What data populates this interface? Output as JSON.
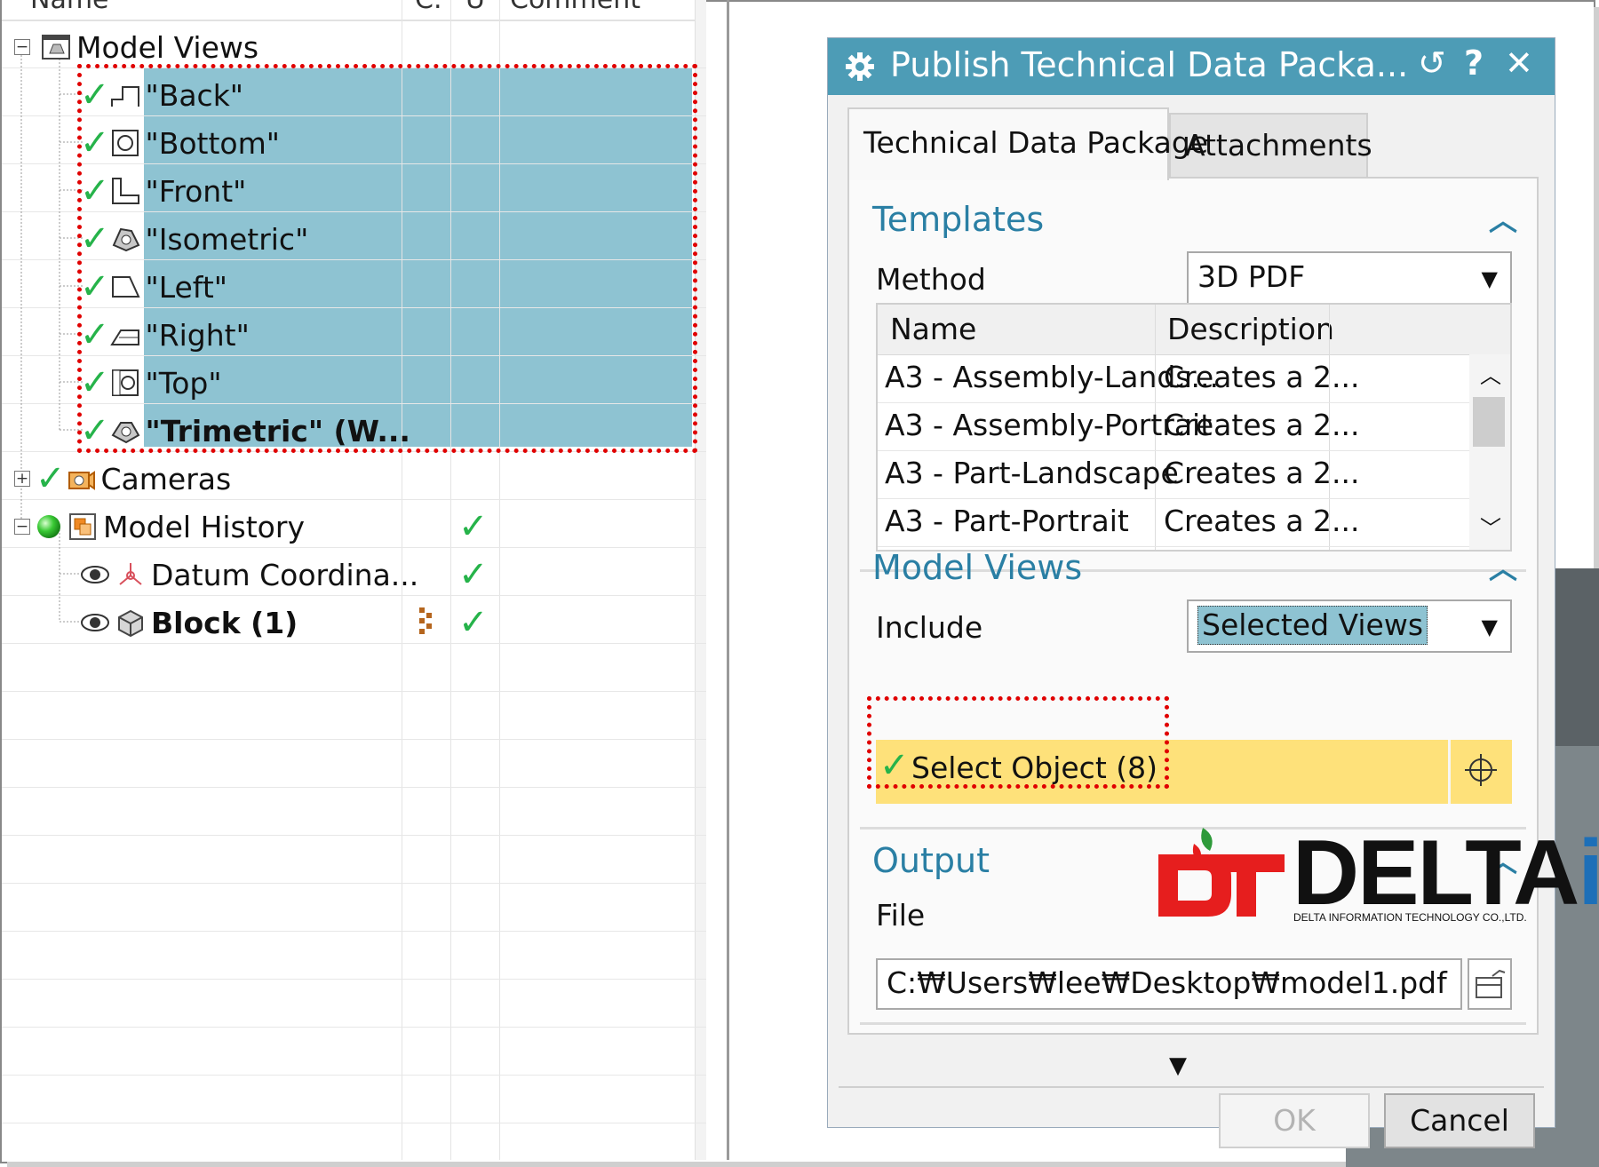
{
  "navigator": {
    "headers": {
      "name": "Name",
      "c": "C.",
      "u": "U",
      "comment": "Comment"
    },
    "model_views": {
      "label": "Model Views",
      "views": [
        {
          "label": "\"Back\"",
          "icon": "view-back-icon"
        },
        {
          "label": "\"Bottom\"",
          "icon": "view-bottom-icon"
        },
        {
          "label": "\"Front\"",
          "icon": "view-front-icon"
        },
        {
          "label": "\"Isometric\"",
          "icon": "view-isometric-icon"
        },
        {
          "label": "\"Left\"",
          "icon": "view-left-icon"
        },
        {
          "label": "\"Right\"",
          "icon": "view-right-icon"
        },
        {
          "label": "\"Top\"",
          "icon": "view-top-icon"
        },
        {
          "label": "\"Trimetric\" (W...",
          "icon": "view-trimetric-icon",
          "bold": true
        }
      ]
    },
    "cameras": {
      "label": "Cameras"
    },
    "model_history": {
      "label": "Model History",
      "items": [
        {
          "label": "Datum Coordina...",
          "icon": "datum-csys-icon",
          "bold": false
        },
        {
          "label": "Block (1)",
          "icon": "block-icon",
          "bold": true
        }
      ]
    }
  },
  "dialog": {
    "title": "Publish Technical Data Packa...",
    "tabs": [
      "Technical Data Package",
      "Attachments"
    ],
    "templates": {
      "title": "Templates",
      "method_label": "Method",
      "method_value": "3D PDF",
      "columns": [
        "Name",
        "Description"
      ],
      "rows": [
        {
          "name": "A3 - Assembly-Lands...",
          "description": "Creates a 2..."
        },
        {
          "name": "A3 - Assembly-Portrait",
          "description": "Creates a 2..."
        },
        {
          "name": "A3 - Part-Landscape",
          "description": "Creates a 2..."
        },
        {
          "name": "A3 - Part-Portrait",
          "description": "Creates a 2..."
        }
      ]
    },
    "model_views": {
      "title": "Model Views",
      "include_label": "Include",
      "include_value": "Selected Views",
      "select_object": "Select Object (8)"
    },
    "output": {
      "title": "Output",
      "file_label": "File",
      "file_value": "C:₩Users₩lee₩Desktop₩model1.pdf"
    },
    "buttons": {
      "ok": "OK",
      "cancel": "Cancel"
    }
  },
  "logo": {
    "text_main": "DELTA",
    "text_accent": "iT",
    "subtitle": "DELTA INFORMATION TECHNOLOGY CO.,LTD."
  },
  "colors": {
    "selection": "#8ec3d2",
    "dialog_title": "#4d9cb6",
    "group_title": "#2a7fa4",
    "select_highlight": "#fee17a",
    "check": "#26b34a",
    "annotation": "#e00000"
  }
}
